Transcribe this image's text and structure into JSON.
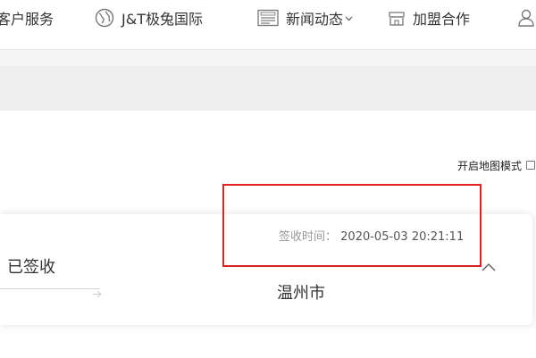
{
  "nav": {
    "items": [
      {
        "label": "客户服务",
        "icon": "customer-service-icon"
      },
      {
        "label": "J&T极兔国际",
        "icon": "globe-icon"
      },
      {
        "label": "新闻动态",
        "icon": "newspaper-icon",
        "has_dropdown": true
      },
      {
        "label": "加盟合作",
        "icon": "store-icon"
      },
      {
        "label": "",
        "icon": "user-icon"
      }
    ]
  },
  "map_mode": {
    "label": "开启地图模式",
    "checked": false
  },
  "tracking": {
    "status": "已签收",
    "sign_time_label": "签收时间：",
    "sign_time_value": "2020-05-03 20:21:11",
    "city": "温州市"
  },
  "colors": {
    "highlight": "#e02020",
    "text_primary": "#333333",
    "text_muted": "#999999"
  }
}
